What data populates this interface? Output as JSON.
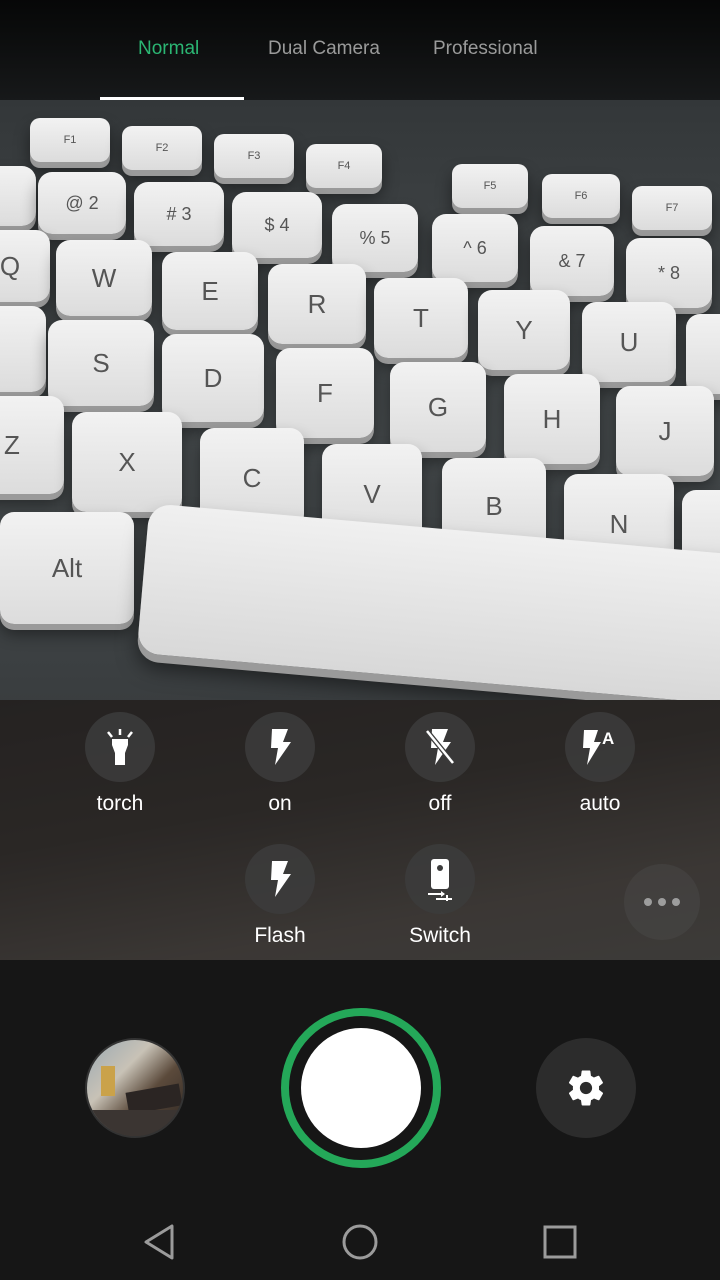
{
  "mode_tabs": [
    {
      "label": "Normal",
      "active": true
    },
    {
      "label": "Dual Camera",
      "active": false
    },
    {
      "label": "Professional",
      "active": false
    }
  ],
  "flash_options": [
    {
      "label": "torch",
      "icon": "flashlight-icon"
    },
    {
      "label": "on",
      "icon": "flash-on-icon"
    },
    {
      "label": "off",
      "icon": "flash-off-icon"
    },
    {
      "label": "auto",
      "icon": "flash-auto-icon"
    }
  ],
  "quick_options": [
    {
      "label": "Flash",
      "icon": "flash-icon"
    },
    {
      "label": "Switch",
      "icon": "camera-switch-icon"
    }
  ],
  "colors": {
    "accent": "#2bb673",
    "shutter_ring": "#24a859",
    "background": "#161616"
  },
  "controls": {
    "gallery_icon": "gallery-thumbnail",
    "shutter_icon": "shutter-button",
    "settings_icon": "gear-icon",
    "more_icon": "more-horizontal-icon"
  },
  "navbar": {
    "back_icon": "back-triangle-icon",
    "home_icon": "home-circle-icon",
    "recents_icon": "recents-square-icon"
  }
}
